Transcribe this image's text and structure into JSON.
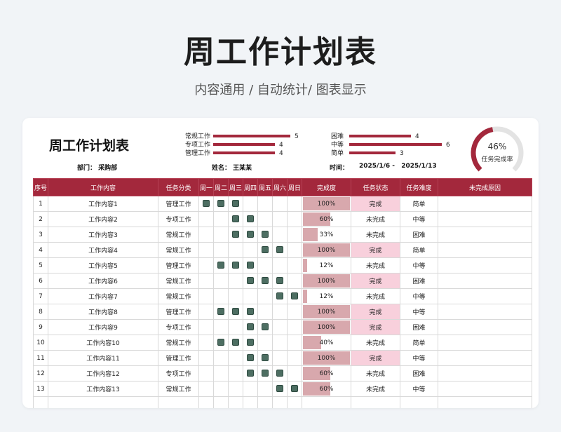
{
  "header": {
    "title": "周工作计划表",
    "subtitle": "内容通用 / 自动统计/ 图表显示"
  },
  "card": {
    "title": "周工作计划表",
    "stats": [
      {
        "label": "常规工作",
        "value": 5
      },
      {
        "label": "专项工作",
        "value": 4
      },
      {
        "label": "管理工作",
        "value": 4
      },
      {
        "label": "困难",
        "value": 4
      },
      {
        "label": "中等",
        "value": 6
      },
      {
        "label": "简单",
        "value": 3
      }
    ],
    "dept_label": "部门：",
    "dept_value": "采购部",
    "name_label": "姓名：",
    "name_value": "王某某",
    "time_label": "时间：",
    "time_start": "2025/1/6",
    "time_sep": "-",
    "time_end": "2025/1/13",
    "gauge": {
      "percent": 46,
      "percent_text": "46%",
      "label": "任务完成率",
      "color": "#a3283c"
    }
  },
  "table": {
    "headers": [
      "序号",
      "工作内容",
      "任务分类",
      "周一",
      "周二",
      "周三",
      "周四",
      "周五",
      "周六",
      "周日",
      "完成度",
      "任务状态",
      "任务难度",
      "未完成原因"
    ],
    "rows": [
      {
        "no": "1",
        "content": "工作内容1",
        "category": "管理工作",
        "days": [
          1,
          1,
          1,
          0,
          0,
          0,
          0
        ],
        "progress": 100,
        "progress_text": "100%",
        "status": "完成",
        "difficulty": "简单",
        "reason": ""
      },
      {
        "no": "2",
        "content": "工作内容2",
        "category": "专项工作",
        "days": [
          0,
          0,
          1,
          1,
          0,
          0,
          0
        ],
        "progress": 60,
        "progress_text": "60%",
        "status": "未完成",
        "difficulty": "中等",
        "reason": ""
      },
      {
        "no": "3",
        "content": "工作内容3",
        "category": "常规工作",
        "days": [
          0,
          0,
          1,
          1,
          1,
          0,
          0
        ],
        "progress": 33,
        "progress_text": "33%",
        "status": "未完成",
        "difficulty": "困难",
        "reason": ""
      },
      {
        "no": "4",
        "content": "工作内容4",
        "category": "常规工作",
        "days": [
          0,
          0,
          0,
          0,
          1,
          1,
          0
        ],
        "progress": 100,
        "progress_text": "100%",
        "status": "完成",
        "difficulty": "简单",
        "reason": ""
      },
      {
        "no": "5",
        "content": "工作内容5",
        "category": "管理工作",
        "days": [
          0,
          1,
          1,
          1,
          0,
          0,
          0
        ],
        "progress": 12,
        "progress_text": "12%",
        "status": "未完成",
        "difficulty": "中等",
        "reason": ""
      },
      {
        "no": "6",
        "content": "工作内容6",
        "category": "常规工作",
        "days": [
          0,
          0,
          0,
          1,
          1,
          1,
          0
        ],
        "progress": 100,
        "progress_text": "100%",
        "status": "完成",
        "difficulty": "困难",
        "reason": ""
      },
      {
        "no": "7",
        "content": "工作内容7",
        "category": "常规工作",
        "days": [
          0,
          0,
          0,
          0,
          0,
          1,
          1
        ],
        "progress": 12,
        "progress_text": "12%",
        "status": "未完成",
        "difficulty": "中等",
        "reason": ""
      },
      {
        "no": "8",
        "content": "工作内容8",
        "category": "管理工作",
        "days": [
          0,
          1,
          1,
          1,
          0,
          0,
          0
        ],
        "progress": 100,
        "progress_text": "100%",
        "status": "完成",
        "difficulty": "中等",
        "reason": ""
      },
      {
        "no": "9",
        "content": "工作内容9",
        "category": "专项工作",
        "days": [
          0,
          0,
          0,
          1,
          1,
          0,
          0
        ],
        "progress": 100,
        "progress_text": "100%",
        "status": "完成",
        "difficulty": "困难",
        "reason": ""
      },
      {
        "no": "10",
        "content": "工作内容10",
        "category": "常规工作",
        "days": [
          0,
          1,
          1,
          1,
          0,
          0,
          0
        ],
        "progress": 40,
        "progress_text": "40%",
        "status": "未完成",
        "difficulty": "简单",
        "reason": ""
      },
      {
        "no": "11",
        "content": "工作内容11",
        "category": "管理工作",
        "days": [
          0,
          0,
          0,
          1,
          1,
          0,
          0
        ],
        "progress": 100,
        "progress_text": "100%",
        "status": "完成",
        "difficulty": "中等",
        "reason": ""
      },
      {
        "no": "12",
        "content": "工作内容12",
        "category": "专项工作",
        "days": [
          0,
          0,
          0,
          1,
          1,
          1,
          0
        ],
        "progress": 60,
        "progress_text": "60%",
        "status": "未完成",
        "difficulty": "困难",
        "reason": ""
      },
      {
        "no": "13",
        "content": "工作内容13",
        "category": "常规工作",
        "days": [
          0,
          0,
          0,
          0,
          0,
          1,
          1
        ],
        "progress": 60,
        "progress_text": "60%",
        "status": "未完成",
        "difficulty": "中等",
        "reason": ""
      }
    ]
  }
}
